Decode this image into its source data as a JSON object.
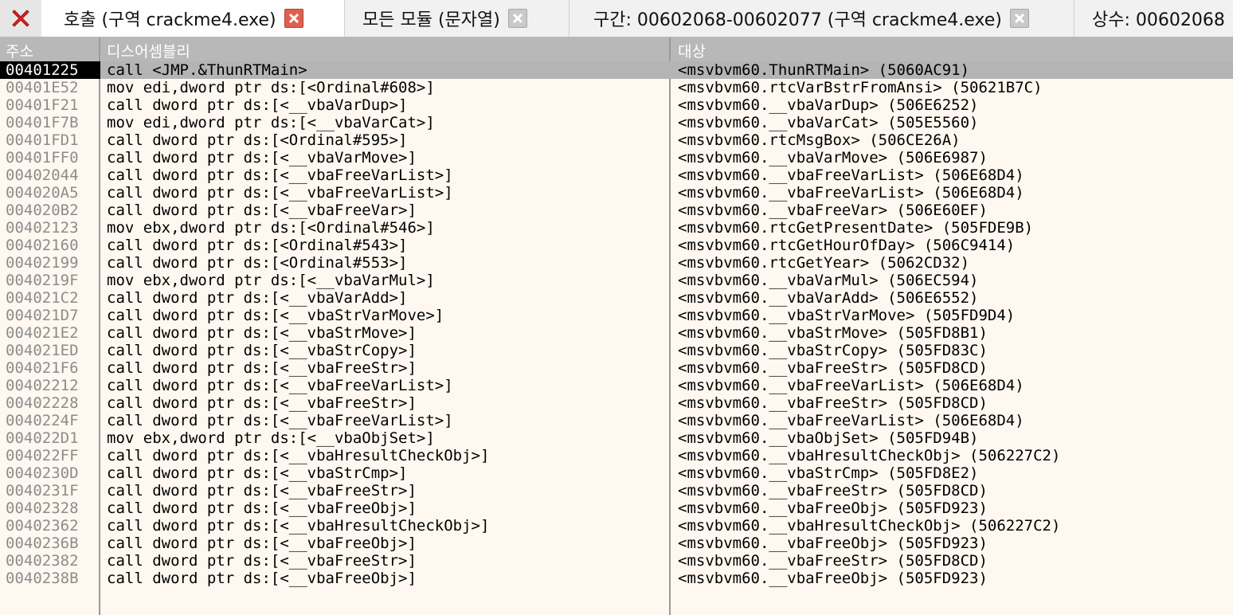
{
  "tabs": [
    {
      "label": "호출 (구역 crackme4.exe)",
      "active": true,
      "close_style": "red"
    },
    {
      "label": "모든 모듈 (문자열)",
      "active": false,
      "close_style": "grey"
    },
    {
      "label": "구간: 00602068-00602077 (구역 crackme4.exe)",
      "active": false,
      "close_style": "grey"
    },
    {
      "label": "상수: 00602068",
      "active": false,
      "close_style": "none"
    }
  ],
  "columns": {
    "address": "주소",
    "disassembly": "디스어셈블리",
    "target": "대상"
  },
  "rows": [
    {
      "address": "00401225",
      "disassembly": "call <JMP.&ThunRTMain>",
      "target": "<msvbvm60.ThunRTMain> (5060AC91)",
      "selected": true
    },
    {
      "address": "00401E52",
      "disassembly": "mov edi,dword ptr ds:[<Ordinal#608>]",
      "target": "<msvbvm60.rtcVarBstrFromAnsi> (50621B7C)"
    },
    {
      "address": "00401F21",
      "disassembly": "call dword ptr ds:[<__vbaVarDup>]",
      "target": "<msvbvm60.__vbaVarDup> (506E6252)"
    },
    {
      "address": "00401F7B",
      "disassembly": "mov edi,dword ptr ds:[<__vbaVarCat>]",
      "target": "<msvbvm60.__vbaVarCat> (505E5560)"
    },
    {
      "address": "00401FD1",
      "disassembly": "call dword ptr ds:[<Ordinal#595>]",
      "target": "<msvbvm60.rtcMsgBox> (506CE26A)"
    },
    {
      "address": "00401FF0",
      "disassembly": "call dword ptr ds:[<__vbaVarMove>]",
      "target": "<msvbvm60.__vbaVarMove> (506E6987)"
    },
    {
      "address": "00402044",
      "disassembly": "call dword ptr ds:[<__vbaFreeVarList>]",
      "target": "<msvbvm60.__vbaFreeVarList> (506E68D4)"
    },
    {
      "address": "004020A5",
      "disassembly": "call dword ptr ds:[<__vbaFreeVarList>]",
      "target": "<msvbvm60.__vbaFreeVarList> (506E68D4)"
    },
    {
      "address": "004020B2",
      "disassembly": "call dword ptr ds:[<__vbaFreeVar>]",
      "target": "<msvbvm60.__vbaFreeVar> (506E60EF)"
    },
    {
      "address": "00402123",
      "disassembly": "mov ebx,dword ptr ds:[<Ordinal#546>]",
      "target": "<msvbvm60.rtcGetPresentDate> (505FDE9B)"
    },
    {
      "address": "00402160",
      "disassembly": "call dword ptr ds:[<Ordinal#543>]",
      "target": "<msvbvm60.rtcGetHourOfDay> (506C9414)"
    },
    {
      "address": "00402199",
      "disassembly": "call dword ptr ds:[<Ordinal#553>]",
      "target": "<msvbvm60.rtcGetYear> (5062CD32)"
    },
    {
      "address": "0040219F",
      "disassembly": "mov ebx,dword ptr ds:[<__vbaVarMul>]",
      "target": "<msvbvm60.__vbaVarMul> (506EC594)"
    },
    {
      "address": "004021C2",
      "disassembly": "call dword ptr ds:[<__vbaVarAdd>]",
      "target": "<msvbvm60.__vbaVarAdd> (506E6552)"
    },
    {
      "address": "004021D7",
      "disassembly": "call dword ptr ds:[<__vbaStrVarMove>]",
      "target": "<msvbvm60.__vbaStrVarMove> (505FD9D4)"
    },
    {
      "address": "004021E2",
      "disassembly": "call dword ptr ds:[<__vbaStrMove>]",
      "target": "<msvbvm60.__vbaStrMove> (505FD8B1)"
    },
    {
      "address": "004021ED",
      "disassembly": "call dword ptr ds:[<__vbaStrCopy>]",
      "target": "<msvbvm60.__vbaStrCopy> (505FD83C)"
    },
    {
      "address": "004021F6",
      "disassembly": "call dword ptr ds:[<__vbaFreeStr>]",
      "target": "<msvbvm60.__vbaFreeStr> (505FD8CD)"
    },
    {
      "address": "00402212",
      "disassembly": "call dword ptr ds:[<__vbaFreeVarList>]",
      "target": "<msvbvm60.__vbaFreeVarList> (506E68D4)"
    },
    {
      "address": "00402228",
      "disassembly": "call dword ptr ds:[<__vbaFreeStr>]",
      "target": "<msvbvm60.__vbaFreeStr> (505FD8CD)"
    },
    {
      "address": "0040224F",
      "disassembly": "call dword ptr ds:[<__vbaFreeVarList>]",
      "target": "<msvbvm60.__vbaFreeVarList> (506E68D4)"
    },
    {
      "address": "004022D1",
      "disassembly": "mov ebx,dword ptr ds:[<__vbaObjSet>]",
      "target": "<msvbvm60.__vbaObjSet> (505FD94B)"
    },
    {
      "address": "004022FF",
      "disassembly": "call dword ptr ds:[<__vbaHresultCheckObj>]",
      "target": "<msvbvm60.__vbaHresultCheckObj> (506227C2)"
    },
    {
      "address": "0040230D",
      "disassembly": "call dword ptr ds:[<__vbaStrCmp>]",
      "target": "<msvbvm60.__vbaStrCmp> (505FD8E2)"
    },
    {
      "address": "0040231F",
      "disassembly": "call dword ptr ds:[<__vbaFreeStr>]",
      "target": "<msvbvm60.__vbaFreeStr> (505FD8CD)"
    },
    {
      "address": "00402328",
      "disassembly": "call dword ptr ds:[<__vbaFreeObj>]",
      "target": "<msvbvm60.__vbaFreeObj> (505FD923)"
    },
    {
      "address": "00402362",
      "disassembly": "call dword ptr ds:[<__vbaHresultCheckObj>]",
      "target": "<msvbvm60.__vbaHresultCheckObj> (506227C2)"
    },
    {
      "address": "0040236B",
      "disassembly": "call dword ptr ds:[<__vbaFreeObj>]",
      "target": "<msvbvm60.__vbaFreeObj> (505FD923)"
    },
    {
      "address": "00402382",
      "disassembly": "call dword ptr ds:[<__vbaFreeStr>]",
      "target": "<msvbvm60.__vbaFreeStr> (505FD8CD)"
    },
    {
      "address": "0040238B",
      "disassembly": "call dword ptr ds:[<__vbaFreeObj>]",
      "target": "<msvbvm60.__vbaFreeObj> (505FD923)"
    }
  ],
  "colors": {
    "background": "#fff8f0",
    "header": "#b8b8b8",
    "selected_row": "#b4b4b4",
    "address_text": "#8c8c8c",
    "close_red": "#e06050"
  },
  "icons": {
    "close_all": "close-all-icon",
    "tab_close": "close-icon"
  }
}
